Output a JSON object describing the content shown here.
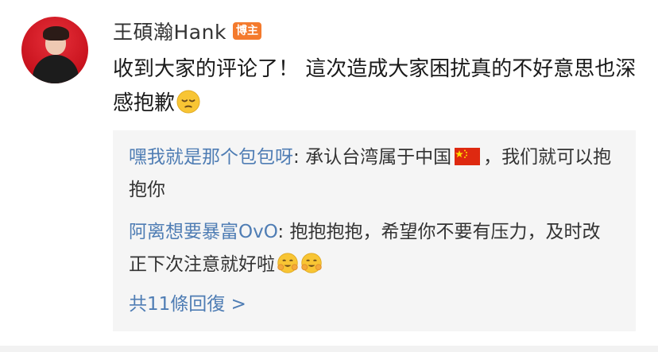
{
  "post": {
    "author_name": "王碩瀚Hank",
    "author_badge": "博主",
    "text": "收到大家的评论了！ 這次造成大家困扰真的不好意思也深感抱歉"
  },
  "replies": [
    {
      "user": "嘿我就是那个包包呀",
      "text_before_flag": "承认台湾属于中国",
      "text_after_flag": "，我们就可以抱抱你"
    },
    {
      "user": "阿离想要暴富OvO",
      "text": "抱抱抱抱，希望你不要有压力，及时改正下次注意就好啦"
    }
  ],
  "more_replies_label": "共11條回復 >",
  "colors": {
    "link_blue": "#4f7db4",
    "badge_orange": "#f47a2d",
    "reply_bg": "#f5f5f5"
  },
  "icons": {
    "pensive_emoji": "pensive-face-icon",
    "hug_emoji": "hugging-face-icon",
    "china_flag": "china-flag-icon"
  }
}
